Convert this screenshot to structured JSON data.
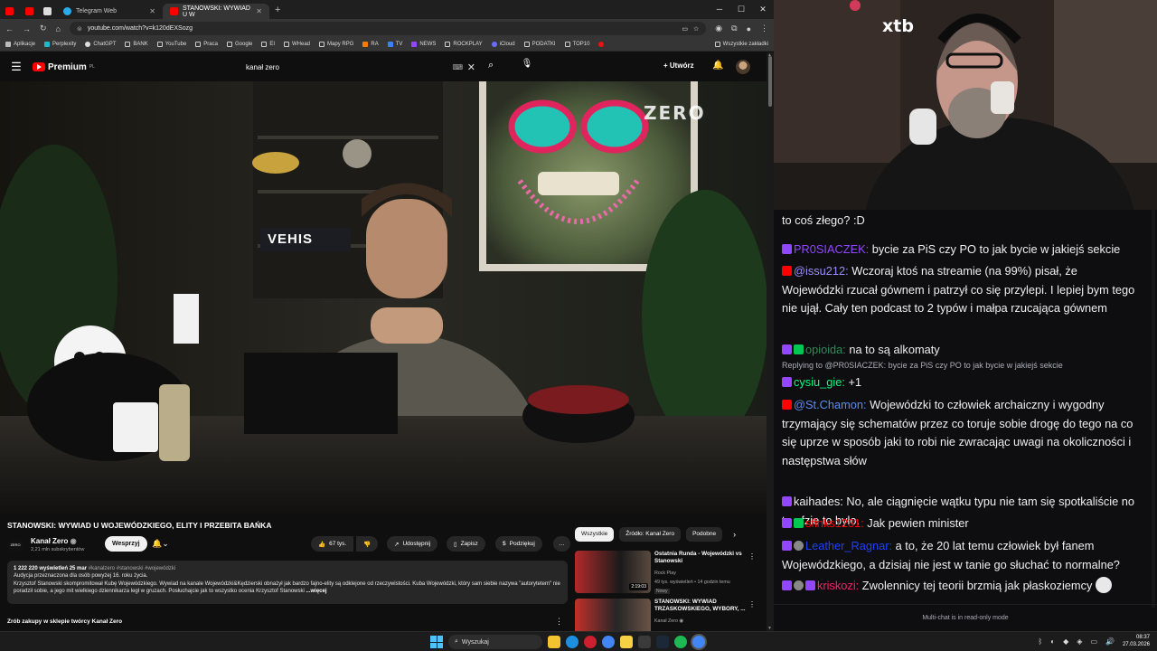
{
  "browser": {
    "tabs": [
      {
        "label": "Telegram Web",
        "color": "#2aabee"
      },
      {
        "label": "STANOWSKI: WYWIAD U W",
        "color": "#ff0000"
      }
    ],
    "url": "youtube.com/watch?v=k120dEXSozg",
    "bookmarks": [
      "Aplikacje",
      "Perplexity",
      "ChatGPT",
      "BANK",
      "YouTube",
      "Praca",
      "Google",
      "EI",
      "WHead",
      "Mapy RPG",
      "RA",
      "TV",
      "NEWS",
      "ROCKPLAY",
      "iCloud",
      "PODATKI",
      "TOP10"
    ],
    "bookmarks_all": "Wszystkie zakładki"
  },
  "youtube": {
    "brand": "Premium",
    "brand_sup": "PL",
    "search_value": "kanał zero",
    "create_label": "Utwórz",
    "watermark": "ZERO",
    "sign_text": "VEHIS",
    "video_title": "STANOWSKI: WYWIAD U WOJEWÓDZKIEGO, ELITY I PRZEBITA BAŃKA",
    "channel_logo_text": "ZERO",
    "channel_name": "Kanał Zero",
    "channel_subs": "2,21 mln subskrybentów",
    "support_label": "Wesprzyj",
    "likes": "67 tys.",
    "share_label": "Udostępnij",
    "save_label": "Zapisz",
    "thanks_label": "Podziękuj",
    "more_label": "…",
    "description": {
      "stats": "1 222 220 wyświetleń  25 mar",
      "tags": "#kanalzero #stanowski #wojewódzki",
      "line1": "Audycja przeznaczona dla osób powyżej 16. roku życia.",
      "line2": "Krzysztof Stanowski skompromitował Kubę Wojewódzkiego. Wywiad na kanale Wojewódzki&Kędzierski obnażył jak bardzo fajno-elity są odklejone od rzeczywistości. Kuba Wojewódzki, który sam siebie nazywa \"autorytetem\" nie poradził sobie, a jego mit wielkiego dziennikarza legł w gruzach. Posłuchajcie jak to wszystko ocenia Krzysztof Stanowski",
      "more": "...więcej"
    },
    "shop_label": "Zrób zakupy w sklepie twórcy Kanał Zero",
    "chips": [
      "Wszystkie",
      "Źródło: Kanał Zero",
      "Podobne"
    ],
    "related": [
      {
        "title": "Ostatnia Runda - Wojewódzki vs Stanowski",
        "channel": "Rock Play",
        "meta": "49 tys. wyświetleń • 14 godzin temu",
        "badge": "Nowy",
        "duration": "2:19:03"
      },
      {
        "title": "STANOWSKI: WYWIAD TRZASKOWSKIEGO, WYBORY, ...",
        "channel": "Kanał Zero",
        "meta": "",
        "badge": "",
        "duration": ""
      }
    ]
  },
  "stream": {
    "sponsor_logo": "xtb"
  },
  "chat": {
    "top_fragment": "to coś złego? :D",
    "messages": [
      {
        "platform": "twitch",
        "user": "PR0SIACZEK:",
        "color": "#9146ff",
        "text": " bycie za PiS czy PO to jak bycie w jakiejś sekcie"
      },
      {
        "platform": "youtube",
        "user": "@issu212:",
        "color": "#9b8cff",
        "text": " Wczoraj ktoś na streamie (na 99%) pisał, że Wojewódzki rzucał gównem i patrzył co się przylepi. I lepiej bym tego nie ujął. Cały ten podcast to 2 typów i małpa rzucająca gównem"
      },
      {
        "platform": "twitch",
        "user": "opioida:",
        "color": "#2e8b57",
        "text": " na to są alkomaty"
      },
      {
        "platform": "reply",
        "text": "Replying to @PR0SIACZEK: bycie za PiS czy PO to jak bycie w jakiejś sekcie"
      },
      {
        "platform": "twitch",
        "user": "cysiu_gie:",
        "color": "#00ff7f",
        "text": " +1"
      },
      {
        "platform": "youtube",
        "user": "@St.Chamon:",
        "color": "#5b8def",
        "text": " Wojewódzki to człowiek archaiczny i wygodny trzymający się schematów przez co toruje sobie drogę do tego na co się uprze w sposób jaki to robi nie zwracając uwagi na okoliczności i następstwa słów"
      },
      {
        "platform": "twitch",
        "user": "kaihades:",
        "color": "#f1f1f1",
        "text": " No, ale ciągnięcie wątku typu nie tam się spotkaliście no to gfzie to było."
      },
      {
        "platform": "twitch",
        "user": "sfinks1231:",
        "color": "#ff0000",
        "text": " Jak pewien minister"
      },
      {
        "platform": "twitch",
        "user": "Leather_Ragnar:",
        "color": "#1e40ff",
        "text": " a to, że 20 lat temu człowiek był fanem Wojewódzkiego, a dzisiaj nie jest w tanie go słuchać to normalne?"
      },
      {
        "platform": "twitch",
        "user": "kriskozi:",
        "color": "#ff1e6e",
        "text": " Zwolennicy tej teorii brzmią jak płaskoziemcy"
      }
    ],
    "footer": "Multi-chat is in read-only mode"
  },
  "taskbar": {
    "search_label": "Wyszukaj",
    "time": "08:37",
    "date": "27.03.2026"
  }
}
